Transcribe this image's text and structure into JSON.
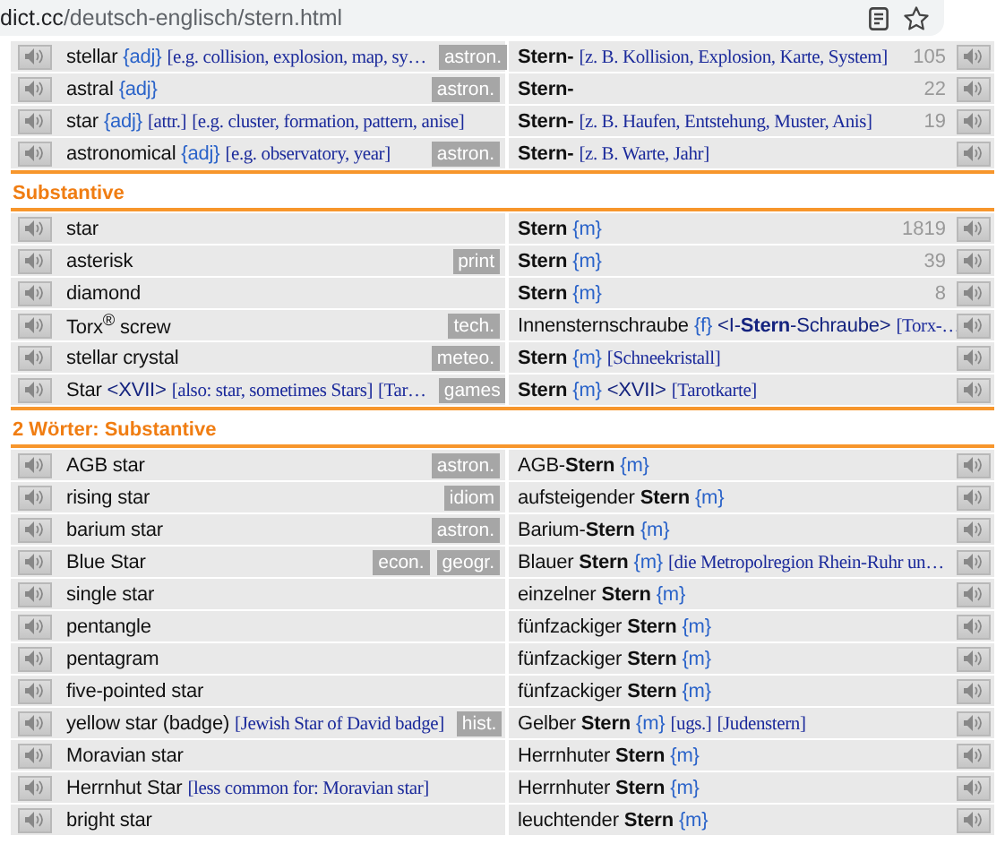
{
  "address_bar": {
    "host": "dict.cc",
    "path": "/deutsch-englisch/stern.html"
  },
  "sections": [
    {
      "rows": [
        {
          "en": [
            {
              "kind": "plain",
              "text": "stellar"
            },
            {
              "kind": "gram",
              "text": "{adj}"
            },
            {
              "kind": "note",
              "text": "[e.g. collision, explosion, map, sy…"
            }
          ],
          "tags": [
            "astron."
          ],
          "de": [
            {
              "kind": "head",
              "text": "Stern-"
            },
            {
              "kind": "note",
              "text": "[z. B. Kollision, Explosion, Karte, System]"
            }
          ],
          "count": "105"
        },
        {
          "en": [
            {
              "kind": "plain",
              "text": "astral"
            },
            {
              "kind": "gram",
              "text": "{adj}"
            }
          ],
          "tags": [
            "astron."
          ],
          "de": [
            {
              "kind": "head",
              "text": "Stern-"
            }
          ],
          "count": "22"
        },
        {
          "en": [
            {
              "kind": "plain",
              "text": "star"
            },
            {
              "kind": "gram",
              "text": "{adj}"
            },
            {
              "kind": "note",
              "text": "[attr.]"
            },
            {
              "kind": "note",
              "text": "[e.g. cluster, formation, pattern, anise]"
            }
          ],
          "tags": [],
          "de": [
            {
              "kind": "head",
              "text": "Stern-"
            },
            {
              "kind": "note",
              "text": "[z. B. Haufen, Entstehung, Muster, Anis]"
            }
          ],
          "count": "19"
        },
        {
          "en": [
            {
              "kind": "plain",
              "text": "astronomical"
            },
            {
              "kind": "gram",
              "text": "{adj}"
            },
            {
              "kind": "note",
              "text": "[e.g. observatory, year]"
            }
          ],
          "tags": [
            "astron."
          ],
          "de": [
            {
              "kind": "head",
              "text": "Stern-"
            },
            {
              "kind": "note",
              "text": "[z. B. Warte, Jahr]"
            }
          ]
        }
      ]
    },
    {
      "heading": "Substantive",
      "rows": [
        {
          "en": [
            {
              "kind": "plain",
              "text": "star"
            }
          ],
          "tags": [],
          "de": [
            {
              "kind": "head",
              "text": "Stern"
            },
            {
              "kind": "gram",
              "text": "{m}"
            }
          ],
          "count": "1819"
        },
        {
          "en": [
            {
              "kind": "plain",
              "text": "asterisk"
            }
          ],
          "tags": [
            "print"
          ],
          "de": [
            {
              "kind": "head",
              "text": "Stern"
            },
            {
              "kind": "gram",
              "text": "{m}"
            }
          ],
          "count": "39"
        },
        {
          "en": [
            {
              "kind": "plain",
              "text": "diamond"
            }
          ],
          "tags": [],
          "de": [
            {
              "kind": "head",
              "text": "Stern"
            },
            {
              "kind": "gram",
              "text": "{m}"
            }
          ],
          "count": "8"
        },
        {
          "en": [
            {
              "kind": "plain",
              "text": "Torx$^{®}$ screw"
            }
          ],
          "tags": [
            "tech."
          ],
          "de": [
            {
              "kind": "plain",
              "text": "Innensternschraube"
            },
            {
              "kind": "gram",
              "text": "{f}"
            },
            {
              "kind": "angle",
              "text": "<I-**Stern**-Schraube>"
            },
            {
              "kind": "note",
              "text": "[Torx-…"
            }
          ]
        },
        {
          "en": [
            {
              "kind": "plain",
              "text": "stellar crystal"
            }
          ],
          "tags": [
            "meteo."
          ],
          "de": [
            {
              "kind": "head",
              "text": "Stern"
            },
            {
              "kind": "gram",
              "text": "{m}"
            },
            {
              "kind": "note",
              "text": "[Schneekristall]"
            }
          ]
        },
        {
          "en": [
            {
              "kind": "plain",
              "text": "Star"
            },
            {
              "kind": "angle",
              "text": "<XVII>"
            },
            {
              "kind": "note",
              "text": "[also: star, sometimes Stars]"
            },
            {
              "kind": "note",
              "text": "[Tar…"
            }
          ],
          "tags": [
            "games"
          ],
          "de": [
            {
              "kind": "head",
              "text": "Stern"
            },
            {
              "kind": "gram",
              "text": "{m}"
            },
            {
              "kind": "angle",
              "text": "<XVII>"
            },
            {
              "kind": "note",
              "text": "[Tarotkarte]"
            }
          ]
        }
      ]
    },
    {
      "heading": "2 Wörter: Substantive",
      "rows": [
        {
          "en": [
            {
              "kind": "plain",
              "text": "AGB star"
            }
          ],
          "tags": [
            "astron."
          ],
          "de": [
            {
              "kind": "plain",
              "text": "AGB-**Stern**"
            },
            {
              "kind": "gram",
              "text": "{m}"
            }
          ]
        },
        {
          "en": [
            {
              "kind": "plain",
              "text": "rising star"
            }
          ],
          "tags": [
            "idiom"
          ],
          "de": [
            {
              "kind": "plain",
              "text": "aufsteigender **Stern**"
            },
            {
              "kind": "gram",
              "text": "{m}"
            }
          ]
        },
        {
          "en": [
            {
              "kind": "plain",
              "text": "barium star"
            }
          ],
          "tags": [
            "astron."
          ],
          "de": [
            {
              "kind": "plain",
              "text": "Barium-**Stern**"
            },
            {
              "kind": "gram",
              "text": "{m}"
            }
          ]
        },
        {
          "en": [
            {
              "kind": "plain",
              "text": "Blue Star"
            }
          ],
          "tags": [
            "econ.",
            "geogr."
          ],
          "de": [
            {
              "kind": "plain",
              "text": "Blauer **Stern**"
            },
            {
              "kind": "gram",
              "text": "{m}"
            },
            {
              "kind": "note",
              "text": "[die Metropolregion Rhein-Ruhr un…"
            }
          ]
        },
        {
          "en": [
            {
              "kind": "plain",
              "text": "single star"
            }
          ],
          "tags": [],
          "de": [
            {
              "kind": "plain",
              "text": "einzelner **Stern**"
            },
            {
              "kind": "gram",
              "text": "{m}"
            }
          ]
        },
        {
          "en": [
            {
              "kind": "plain",
              "text": "pentangle"
            }
          ],
          "tags": [],
          "de": [
            {
              "kind": "plain",
              "text": "fünfzackiger **Stern**"
            },
            {
              "kind": "gram",
              "text": "{m}"
            }
          ]
        },
        {
          "en": [
            {
              "kind": "plain",
              "text": "pentagram"
            }
          ],
          "tags": [],
          "de": [
            {
              "kind": "plain",
              "text": "fünfzackiger **Stern**"
            },
            {
              "kind": "gram",
              "text": "{m}"
            }
          ]
        },
        {
          "en": [
            {
              "kind": "plain",
              "text": "five-pointed star"
            }
          ],
          "tags": [],
          "de": [
            {
              "kind": "plain",
              "text": "fünfzackiger **Stern**"
            },
            {
              "kind": "gram",
              "text": "{m}"
            }
          ]
        },
        {
          "en": [
            {
              "kind": "plain",
              "text": "yellow star (badge)"
            },
            {
              "kind": "note",
              "text": "[Jewish Star of David badge]"
            }
          ],
          "tags": [
            "hist."
          ],
          "de": [
            {
              "kind": "plain",
              "text": "Gelber **Stern**"
            },
            {
              "kind": "gram",
              "text": "{m}"
            },
            {
              "kind": "note",
              "text": "[ugs.]"
            },
            {
              "kind": "note",
              "text": "[Judenstern]"
            }
          ]
        },
        {
          "en": [
            {
              "kind": "plain",
              "text": "Moravian star"
            }
          ],
          "tags": [],
          "de": [
            {
              "kind": "plain",
              "text": "Herrnhuter **Stern**"
            },
            {
              "kind": "gram",
              "text": "{m}"
            }
          ]
        },
        {
          "en": [
            {
              "kind": "plain",
              "text": "Herrnhut Star"
            },
            {
              "kind": "note",
              "text": "[less common for: Moravian star]"
            }
          ],
          "tags": [],
          "de": [
            {
              "kind": "plain",
              "text": "Herrnhuter **Stern**"
            },
            {
              "kind": "gram",
              "text": "{m}"
            }
          ]
        },
        {
          "en": [
            {
              "kind": "plain",
              "text": "bright star"
            }
          ],
          "tags": [],
          "de": [
            {
              "kind": "plain",
              "text": "leuchtender **Stern**"
            },
            {
              "kind": "gram",
              "text": "{m}"
            }
          ]
        }
      ]
    }
  ]
}
